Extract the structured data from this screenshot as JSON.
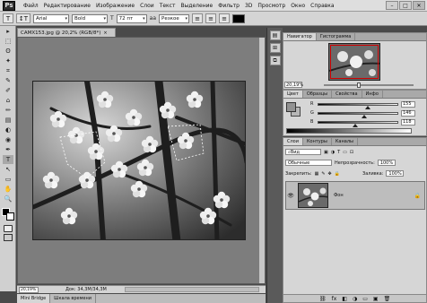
{
  "menu": {
    "logo": "Ps",
    "items": [
      "Файл",
      "Редактирование",
      "Изображение",
      "Слои",
      "Текст",
      "Выделение",
      "Фильтр",
      "3D",
      "Просмотр",
      "Окно",
      "Справка"
    ]
  },
  "window_controls": {
    "minimize": "–",
    "maximize": "□",
    "close": "✕"
  },
  "options": {
    "tool_glyph": "T",
    "orient_glyph": "↕T",
    "font_family": "Arial",
    "font_style": "Bold",
    "size_glyph": "T",
    "font_size": "72 пт",
    "aa_glyph": "aa",
    "aa_value": "Резкое",
    "align": [
      "≡",
      "≡",
      "≡"
    ]
  },
  "document": {
    "tab_title": "CAMX153.jpg @ 20,2% (RGB/8*)",
    "close": "×",
    "zoom": "20,19%",
    "doc_size": "Док: 34,3M/34,3M",
    "bottom_tabs": [
      "Mini Bridge",
      "Шкала времени"
    ]
  },
  "tools": [
    "▸",
    "⬚",
    "ʘ",
    "✦",
    "⌗",
    "✎",
    "✐",
    "⌂",
    "✏",
    "▤",
    "◐",
    "◉",
    "✒",
    "T",
    "↖",
    "▭",
    "✋",
    "🔍"
  ],
  "dock_icons": [
    "▤",
    "⊞",
    "⧉"
  ],
  "navigator": {
    "tabs": [
      "Навигатор",
      "Гистограмма"
    ],
    "zoom": "20,19%"
  },
  "color": {
    "tabs": [
      "Цвет",
      "Образцы",
      "Свойства",
      "Инфо"
    ],
    "channels": [
      {
        "name": "R",
        "value": "155",
        "pos": 0.61
      },
      {
        "name": "G",
        "value": "146",
        "pos": 0.57
      },
      {
        "name": "B",
        "value": "118",
        "pos": 0.46
      }
    ]
  },
  "layers": {
    "tabs": [
      "Слои",
      "Контуры",
      "Каналы"
    ],
    "kind_label": "Вид",
    "blend_mode": "Обычные",
    "opacity_label": "Непрозрачность:",
    "opacity": "100%",
    "lock_label": "Закрепить:",
    "fill_label": "Заливка:",
    "fill": "100%",
    "layer_name": "Фон",
    "eye": "👁",
    "lock_icon": "🔒",
    "footer_icons": [
      "⛓",
      "fx",
      "◧",
      "◑",
      "▭",
      "▣",
      "🗑"
    ]
  }
}
